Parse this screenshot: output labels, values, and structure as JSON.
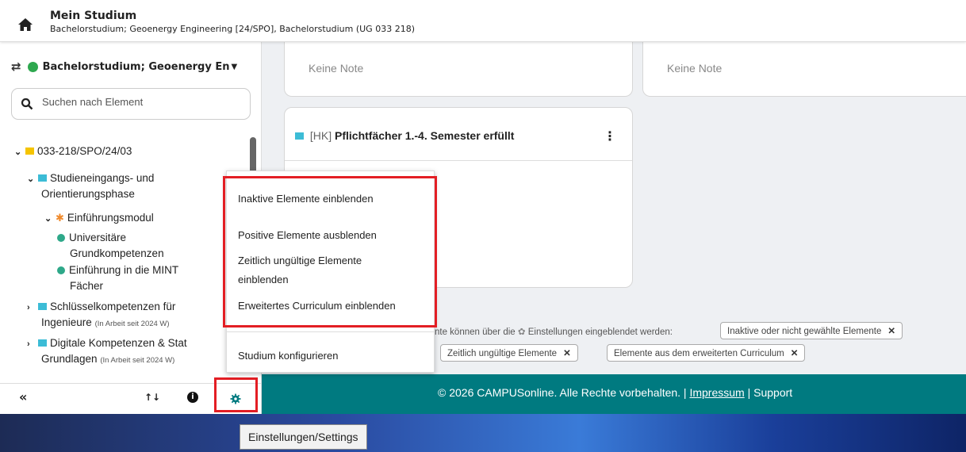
{
  "header": {
    "title": "Mein Studium",
    "subtitle": "Bachelorstudium; Geoenergy Engineering [24/SPO], Bachelorstudium (UG 033 218)"
  },
  "sidebar": {
    "program_selector": "Bachelorstudium; Geoenergy En",
    "search_placeholder": "Suchen nach Element",
    "tree": {
      "root": "033-218/SPO/24/03",
      "stp_line1": "Studieneingangs- und",
      "stp_line2": "Orientierungsphase",
      "einf_modul": "Einführungsmodul",
      "uni_line1": "Universitäre",
      "uni_line2": "Grundkompetenzen",
      "mint_line1": "Einführung in die MINT",
      "mint_line2": "Fächer",
      "schluessel_line1": "Schlüsselkompetenzen für",
      "schluessel_line2": "Ingenieure",
      "schluessel_status": "(In Arbeit seit 2024 W)",
      "digital_line1": "Digitale Kompetenzen & Stat",
      "digital_line2": "Grundlagen",
      "digital_status": "(In Arbeit seit 2024 W)"
    },
    "footer": {
      "collapse": "«",
      "sort": "↑↓",
      "info": "i"
    }
  },
  "cards": {
    "grade1": "Keine Note",
    "grade2": "Keine Note",
    "card3_tag": "[HK]",
    "card3_title": "Pflichtfächer 1.-4. Semester erfüllt"
  },
  "filters": {
    "hint_prefix": "nte können über die",
    "hint_suffix": "Einstellungen eingeblendet werden:",
    "chips": [
      "Inaktive oder nicht gewählte Elemente",
      "Zeitlich ungültige Elemente",
      "Elemente aus dem erweiterten Curriculum"
    ],
    "chip_close": "✕"
  },
  "menu": {
    "item1": "Inaktive Elemente einblenden",
    "item2": "Positive Elemente ausblenden",
    "item3_line1": "Zeitlich ungültige Elemente",
    "item3_line2": "einblenden",
    "item4": "Erweitertes Curriculum einblenden",
    "item5": "Studium konfigurieren"
  },
  "footer": {
    "copyright": "© 2026 CAMPUSonline. Alle Rechte vorbehalten. | ",
    "impressum": "Impressum",
    "sep": " | ",
    "support": "Support"
  },
  "tooltip": "Einstellungen/Settings",
  "colors": {
    "accent": "#007a80",
    "highlight": "#e31e24",
    "folder_yellow": "#f5c400",
    "node_cyan": "#3cbcd6",
    "module_orange": "#f08a2c",
    "leaf_green": "#2ea889"
  }
}
